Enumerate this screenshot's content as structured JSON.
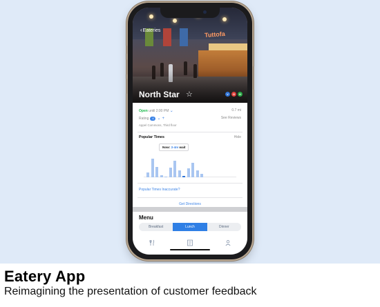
{
  "screen": {
    "back_label": "Eateries",
    "restaurant_name": "North Star",
    "status_badges": [
      {
        "label": "V",
        "color": "#2f74d8"
      },
      {
        "label": "G",
        "color": "#e0403a"
      },
      {
        "label": "H",
        "color": "#27a844"
      }
    ],
    "info": {
      "open_status": "Open",
      "open_until": "until 2:00 PM",
      "distance": "0.7 mi",
      "rating_label": "Rating",
      "rating_value": "4",
      "see_reviews": "See Reviews",
      "address": "Appel Commons, Third floor"
    },
    "popular_times": {
      "title": "Popular Times",
      "hide_label": "Hide",
      "now_prefix": "Now:",
      "now_value": "3-4m",
      "now_suffix": "wait",
      "inaccurate_link": "Popular Times Inaccurate?",
      "current_index": 8,
      "bars": [
        0.22,
        0.78,
        0.45,
        0.1,
        0.04,
        0.42,
        0.72,
        0.3,
        0.05,
        0.38,
        0.62,
        0.3,
        0.16
      ]
    },
    "get_directions": "Get Directions",
    "menu": {
      "title": "Menu",
      "segments": [
        "Breakfast",
        "Lunch",
        "Dinner"
      ],
      "active_segment": "Lunch"
    },
    "tabbar": [
      "utensils-icon",
      "menu-list-icon",
      "profile-icon"
    ]
  },
  "caption": {
    "title": "Eatery App",
    "subtitle": "Reimagining the presentation of customer feedback"
  },
  "colors": {
    "background": "#dfeaf8",
    "accent": "#2f7fe5",
    "open_green": "#19b84a"
  }
}
